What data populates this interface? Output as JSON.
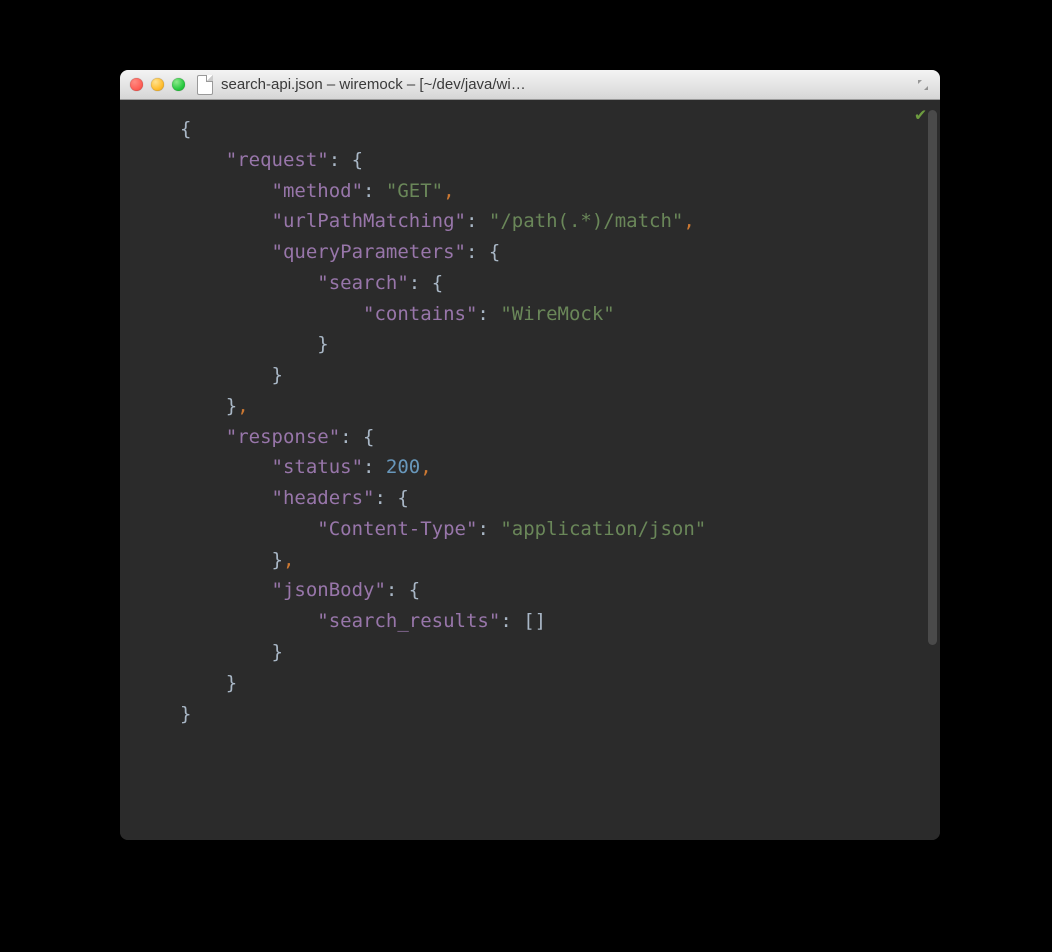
{
  "window": {
    "title": "search-api.json – wiremock – [~/dev/java/wi…"
  },
  "status": {
    "ok_glyph": "✔"
  },
  "code": {
    "open_brace": "{",
    "close_brace": "}",
    "open_bracket": "[",
    "close_bracket": "]",
    "colon_space": ": ",
    "comma": ",",
    "keys": {
      "request": "\"request\"",
      "method": "\"method\"",
      "urlPathMatching": "\"urlPathMatching\"",
      "queryParameters": "\"queryParameters\"",
      "search": "\"search\"",
      "contains": "\"contains\"",
      "response": "\"response\"",
      "status": "\"status\"",
      "headers": "\"headers\"",
      "content_type": "\"Content-Type\"",
      "jsonBody": "\"jsonBody\"",
      "search_results": "\"search_results\""
    },
    "vals": {
      "method": "\"GET\"",
      "urlPathMatching": "\"/path(.*)/match\"",
      "contains": "\"WireMock\"",
      "status": "200",
      "content_type": "\"application/json\""
    }
  }
}
